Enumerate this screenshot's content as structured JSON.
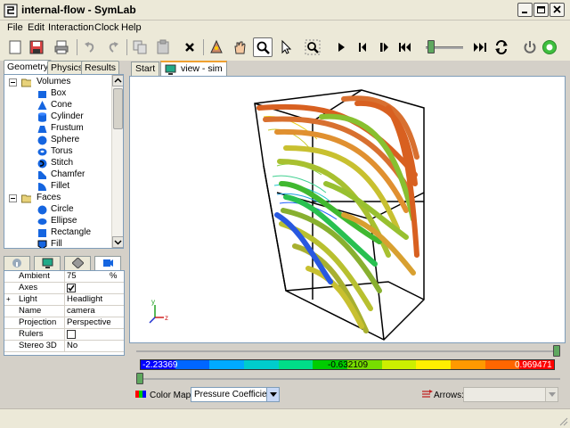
{
  "window": {
    "title": "internal-flow - SymLab"
  },
  "menu": [
    "File",
    "Edit",
    "Interaction",
    "Clock",
    "Help"
  ],
  "toolbar": {
    "buttons": [
      "new",
      "save",
      "print",
      "undo",
      "redo",
      "copy",
      "paste",
      "delete",
      "light",
      "hand",
      "zoom",
      "select",
      "zoom-fit",
      "play",
      "step-back",
      "pause",
      "rewind",
      "skip-end",
      "loop",
      "power",
      "record"
    ],
    "time_slider_fraction": 0.05
  },
  "left_tabs": [
    "Geometry",
    "Physics",
    "Results"
  ],
  "tree": {
    "volumes_label": "Volumes",
    "volume_items": [
      "Box",
      "Cone",
      "Cylinder",
      "Frustum",
      "Sphere",
      "Torus",
      "Stitch",
      "Chamfer",
      "Fillet"
    ],
    "faces_label": "Faces",
    "face_items": [
      "Circle",
      "Ellipse",
      "Rectangle",
      "Fill"
    ]
  },
  "properties": [
    {
      "name": "Ambient",
      "value": "75",
      "unit": "%"
    },
    {
      "name": "Axes",
      "value": "",
      "checked": true
    },
    {
      "name": "Light",
      "value": "Headlight",
      "expandable": true
    },
    {
      "name": "Name",
      "value": "camera"
    },
    {
      "name": "Projection",
      "value": "Perspective"
    },
    {
      "name": "Rulers",
      "value": "",
      "checked": false
    },
    {
      "name": "Stereo 3D",
      "value": "No"
    }
  ],
  "view_tabs": [
    "Start",
    "view - sim"
  ],
  "axis_labels": {
    "y": "y",
    "x": "x",
    "z": "z"
  },
  "colorbar": {
    "min_label": "-2.23369",
    "mid_label": "-0.632109",
    "max_label": "0.969471",
    "colors": [
      "#0000ff",
      "#0066ff",
      "#00aaff",
      "#00cccc",
      "#00dd88",
      "#00cc00",
      "#77dd00",
      "#ccee00",
      "#ffee00",
      "#ff9900",
      "#ff6600",
      "#ff0000"
    ],
    "low_threshold_fraction": 0.0,
    "high_threshold_fraction": 1.0
  },
  "color_map": {
    "label": "Color Map:",
    "selected": "Pressure Coefficient"
  },
  "arrows": {
    "label": "Arrows:",
    "selected": ""
  }
}
